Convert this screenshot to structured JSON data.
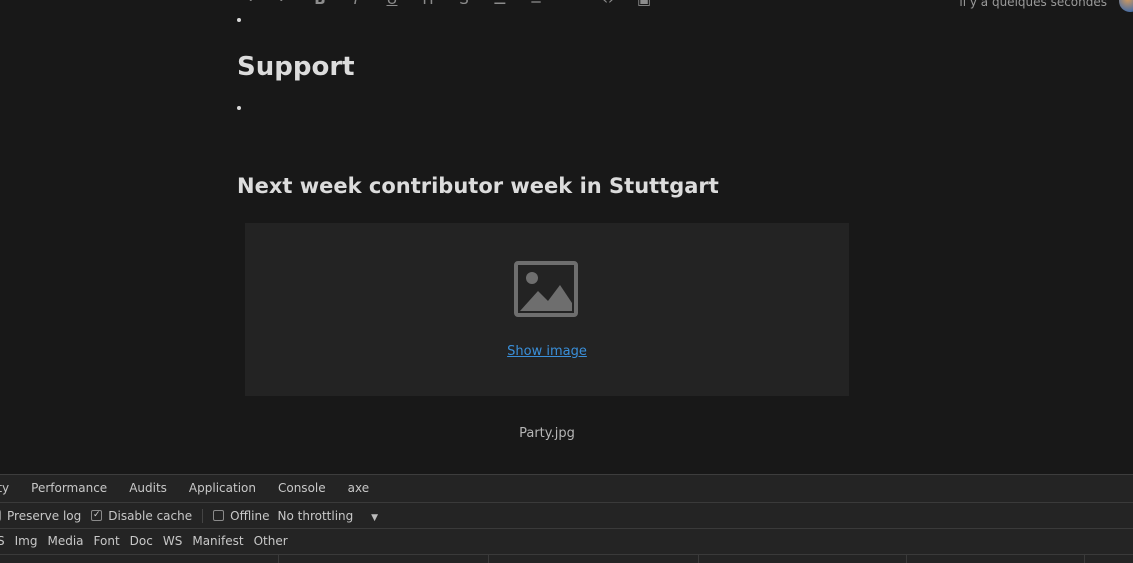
{
  "editor": {
    "toolbar": {
      "icons": [
        "redo-icon",
        "undo-icon",
        "bold-icon",
        "italic-icon",
        "underline-icon",
        "heading-icon",
        "strikethrough-icon",
        "bullet-list-icon",
        "ordered-list-icon",
        "quote-icon",
        "code-icon",
        "image-insert-icon"
      ]
    },
    "timestamp": "il y a quelques secondes",
    "heading_support": "Support",
    "heading_next": "Next week contributor week in Stuttgart",
    "image": {
      "placeholder_icon": "image-placeholder-icon",
      "show_label": "Show image",
      "caption": "Party.jpg"
    }
  },
  "devtools": {
    "tabs": [
      "ity",
      "Performance",
      "Audits",
      "Application",
      "Console",
      "axe"
    ],
    "options": {
      "preserve_log": "Preserve log",
      "disable_cache": "Disable cache",
      "offline": "Offline",
      "throttling": "No throttling"
    },
    "filters": [
      "S",
      "Img",
      "Media",
      "Font",
      "Doc",
      "WS",
      "Manifest",
      "Other"
    ]
  }
}
